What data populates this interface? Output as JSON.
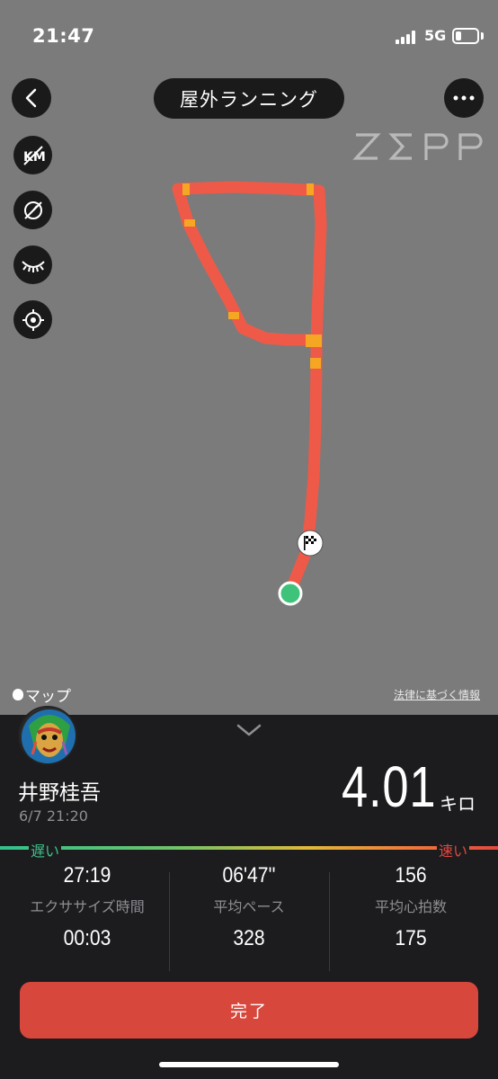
{
  "status_bar": {
    "time": "21:47",
    "network": "5G",
    "battery_level": 0.25
  },
  "header": {
    "title": "屋外ランニング",
    "back_icon": "chevron-left-icon",
    "more_icon": "more-horizontal-icon"
  },
  "brand": {
    "logo_text": "ZEPP"
  },
  "map_tools": [
    {
      "name": "km-markers-toggle",
      "icon": "km-markers-off-icon"
    },
    {
      "name": "pace-toggle",
      "icon": "speed-off-icon"
    },
    {
      "name": "visibility-toggle",
      "icon": "eye-closed-icon"
    },
    {
      "name": "recenter",
      "icon": "locate-icon"
    }
  ],
  "map": {
    "provider": "マップ",
    "legal": "法律に基づく情報",
    "route_color": "#ef5a48",
    "highlight_color": "#f5a623",
    "start_marker_color": "#3fc37a"
  },
  "summary": {
    "user_name": "井野桂吾",
    "datetime": "6/7 21:20",
    "distance": "4.01",
    "distance_unit": "キロ"
  },
  "pace_legend": {
    "slow": "遅い",
    "fast": "速い"
  },
  "stats": [
    {
      "value": "27:19",
      "label": "エクササイズ時間",
      "value2": "00:03"
    },
    {
      "value": "06'47''",
      "label": "平均ペース",
      "value2": "328"
    },
    {
      "value": "156",
      "label": "平均心拍数",
      "value2": "175"
    }
  ],
  "actions": {
    "done": "完了"
  },
  "colors": {
    "accent": "#d8473c",
    "map_bg": "#7b7b7b",
    "panel_bg": "#1c1c1e"
  }
}
